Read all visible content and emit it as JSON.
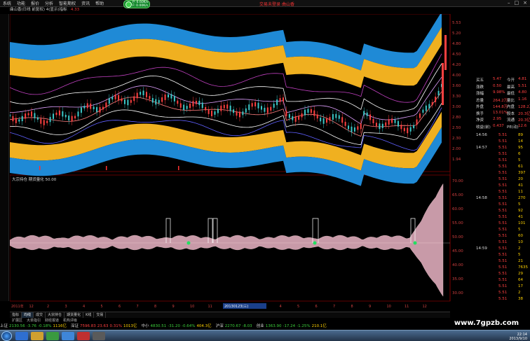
{
  "menu": {
    "items": [
      "系统",
      "功能",
      "报价",
      "分析",
      "智能期权",
      "资讯",
      "帮助"
    ],
    "right_links": [
      "交易未登录",
      "曲山香"
    ],
    "network_status": [
      "P: 6.60K/s",
      "F: 0.00K/s"
    ]
  },
  "title": {
    "text": "曲山香(日线 前复权) 4(显示)指标",
    "price": "4.33"
  },
  "main_axis": [
    "5.53",
    "5.20",
    "4.80",
    "4.50",
    "4.20",
    "4.00",
    "3.60",
    "3.30",
    "3.00",
    "2.80",
    "2.50",
    "2.30",
    "2.00",
    "1.94"
  ],
  "sub_panel": {
    "label": "大宗持仓  期货量化 50.00",
    "axis": [
      "70.00",
      "65.00",
      "60.00",
      "55.00",
      "50.00",
      "45.00",
      "40.00",
      "35.00",
      "30.00"
    ]
  },
  "quote": {
    "rows": [
      {
        "a": "买五",
        "b": "5.47",
        "c": "今开",
        "d": "4.81"
      },
      {
        "a": "涨跌",
        "b": "0.50",
        "c": "最高",
        "d": "5.51"
      },
      {
        "a": "涨幅",
        "b": "9.98%",
        "c": "最低",
        "d": "4.80"
      },
      {
        "a": "总量",
        "b": "264.2万",
        "c": "量比",
        "d": "1.16"
      },
      {
        "a": "外盘",
        "b": "144.8万",
        "c": "内盘",
        "d": "128.2万"
      },
      {
        "a": "换手",
        "b": "13.01%",
        "c": "股本",
        "d": "20.3亿"
      },
      {
        "a": "净资",
        "b": "2.95",
        "c": "流通",
        "d": "20.3亿"
      },
      {
        "a": "收益(前)",
        "b": "0.437",
        "c": "PE(动)",
        "d": "12.6"
      }
    ]
  },
  "ticks": [
    {
      "t": "14:56",
      "p": "5.51",
      "v": "89"
    },
    {
      "t": "",
      "p": "5.51",
      "v": "14"
    },
    {
      "t": "14:57",
      "p": "5.51",
      "v": "95"
    },
    {
      "t": "",
      "p": "5.51",
      "v": "6"
    },
    {
      "t": "",
      "p": "5.51",
      "v": "5"
    },
    {
      "t": "",
      "p": "5.51",
      "v": "61"
    },
    {
      "t": "",
      "p": "5.51",
      "v": "397"
    },
    {
      "t": "",
      "p": "5.51",
      "v": "20"
    },
    {
      "t": "",
      "p": "5.51",
      "v": "41"
    },
    {
      "t": "",
      "p": "5.51",
      "v": "11"
    },
    {
      "t": "14:58",
      "p": "5.51",
      "v": "270"
    },
    {
      "t": "",
      "p": "5.51",
      "v": "5"
    },
    {
      "t": "",
      "p": "5.51",
      "v": "92"
    },
    {
      "t": "",
      "p": "5.51",
      "v": "41"
    },
    {
      "t": "",
      "p": "5.51",
      "v": "101"
    },
    {
      "t": "",
      "p": "5.51",
      "v": "5"
    },
    {
      "t": "",
      "p": "5.51",
      "v": "60"
    },
    {
      "t": "",
      "p": "5.51",
      "v": "10"
    },
    {
      "t": "14:59",
      "p": "5.51",
      "v": "2"
    },
    {
      "t": "",
      "p": "5.51",
      "v": "5"
    },
    {
      "t": "",
      "p": "5.51",
      "v": "21"
    },
    {
      "t": "",
      "p": "5.51",
      "v": "7635"
    },
    {
      "t": "",
      "p": "5.51",
      "v": "29"
    },
    {
      "t": "",
      "p": "5.51",
      "v": "64"
    },
    {
      "t": "",
      "p": "5.51",
      "v": "17"
    },
    {
      "t": "",
      "p": "5.51",
      "v": "2"
    },
    {
      "t": "",
      "p": "5.51",
      "v": "38"
    }
  ],
  "date_axis": [
    "2011年",
    "12",
    "2",
    "3",
    "4",
    "5",
    "6",
    "7",
    "8",
    "9",
    "10",
    "11",
    "12",
    "2",
    "3",
    "4",
    "5",
    "6",
    "7",
    "8",
    "9",
    "10",
    "11",
    "12"
  ],
  "date_highlight": "20130123(三)",
  "bottom_tabs": [
    "指标",
    "均线",
    "成交",
    "大宗持仓",
    "期货量化",
    "K线",
    "交易"
  ],
  "sub_tabs": [
    "扩展区",
    "大单指引",
    "财经报道",
    "机构评级"
  ],
  "index_bar": [
    {
      "name": "上证",
      "value": "2130.56",
      "chg": "-3.76",
      "pct": "-0.18%",
      "amt": "1116亿"
    },
    {
      "name": "深证",
      "value": "7596.83",
      "chg": "23.63",
      "pct": "0.31%",
      "amt": "1013亿"
    },
    {
      "name": "中小",
      "value": "4830.51",
      "chg": "-31.20",
      "pct": "-0.64%",
      "amt": "404.3亿"
    },
    {
      "name": "沪深",
      "value": "2270.67",
      "chg": "-8.03",
      "pct": "",
      "amt": ""
    },
    {
      "name": "创业",
      "value": "1363.90",
      "chg": "-17.24",
      "pct": "-1.25%",
      "amt": "210.1亿"
    }
  ],
  "watermark": "www.7gpzb.com",
  "clock": [
    "22:14",
    "2013/9/10"
  ],
  "colors": {
    "up": "#ff4040",
    "down": "#3ccf3c",
    "band_blue": "#1f8ad6",
    "band_gold": "#f0b020"
  }
}
